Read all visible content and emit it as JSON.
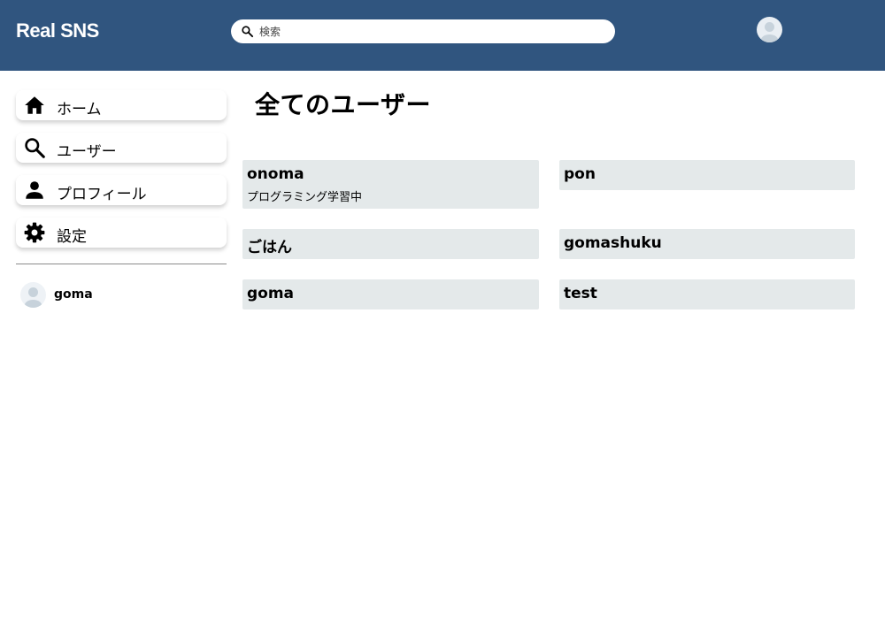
{
  "header": {
    "brand": "Real SNS",
    "search": {
      "placeholder": "検索",
      "value": ""
    }
  },
  "sidebar": {
    "items": [
      {
        "label": "ホーム",
        "icon": "home-icon"
      },
      {
        "label": "ユーザー",
        "icon": "search-icon"
      },
      {
        "label": "プロフィール",
        "icon": "person-icon"
      },
      {
        "label": "設定",
        "icon": "gear-icon"
      }
    ],
    "friends": [
      {
        "name": "goma"
      }
    ]
  },
  "main": {
    "title": "全てのユーザー",
    "users": [
      {
        "name": "onoma",
        "bio": "プログラミング学習中"
      },
      {
        "name": "pon",
        "bio": ""
      },
      {
        "name": "ごはん",
        "bio": ""
      },
      {
        "name": "gomashuku",
        "bio": ""
      },
      {
        "name": "goma",
        "bio": ""
      },
      {
        "name": "test",
        "bio": ""
      }
    ]
  },
  "colors": {
    "header_bg": "#30557f",
    "card_bg": "#e4e9ea",
    "avatar_bg": "#e9eef3",
    "avatar_fg": "#c7d2db"
  }
}
